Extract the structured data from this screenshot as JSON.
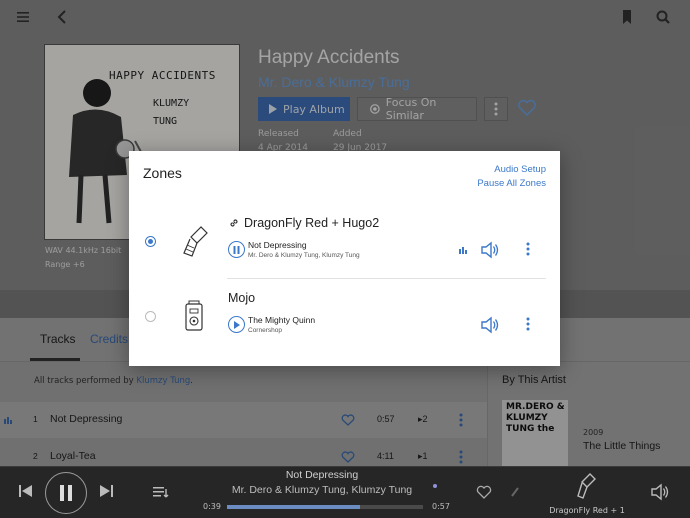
{
  "colors": {
    "accent": "#3b78c9",
    "link": "#6ea1e0",
    "player_bg": "#262626"
  },
  "header": {
    "icons": [
      "hamburger-menu-icon",
      "back-arrow-icon",
      "bookmark-icon",
      "search-icon"
    ]
  },
  "album": {
    "title": "Happy Accidents",
    "artist": "Mr. Dero & Klumzy Tung",
    "cover_text_1": "HAPPY ACCIDENTS",
    "cover_text_2": "KLUMZY TUNG",
    "format": "WAV 44.1kHz 16bit",
    "range": "Range +6",
    "play_label": "Play Album",
    "focus_label": "Focus On Similar",
    "released_label": "Released",
    "released_value": "4 Apr 2014",
    "added_label": "Added",
    "added_value": "29 Jun 2017"
  },
  "tabs": [
    {
      "label": "Tracks",
      "active": true
    },
    {
      "label": "Credits",
      "active": false
    }
  ],
  "performed": {
    "prefix": "All tracks performed by ",
    "artist": "Klumzy Tung",
    "suffix": "."
  },
  "tracks": [
    {
      "num": "1",
      "title": "Not Depressing",
      "duration": "0:57",
      "plays": "2"
    },
    {
      "num": "2",
      "title": "Loyal-Tea",
      "duration": "4:11",
      "plays": "1"
    }
  ],
  "by_artist": {
    "heading": "By This Artist",
    "cover_text": "MR.DERO & KLUMZY TUNG the",
    "year": "2009",
    "album": "The Little Things"
  },
  "zones_dialog": {
    "title": "Zones",
    "audio_setup": "Audio Setup",
    "pause_all": "Pause All Zones",
    "zones": [
      {
        "name": "DragonFly Red + Hugo2",
        "selected": true,
        "track": "Not Depressing",
        "artists": "Mr. Dero & Klumzy Tung, Klumzy Tung",
        "state": "playing",
        "linked": true
      },
      {
        "name": "Mojo",
        "selected": false,
        "track": "The Mighty Quinn",
        "artists": "Cornershop",
        "state": "paused",
        "linked": false
      }
    ]
  },
  "player": {
    "title": "Not Depressing",
    "artist": "Mr. Dero & Klumzy Tung, Klumzy Tung",
    "elapsed": "0:39",
    "total": "0:57",
    "progress": 0.68,
    "zone": "DragonFly Red + 1"
  }
}
